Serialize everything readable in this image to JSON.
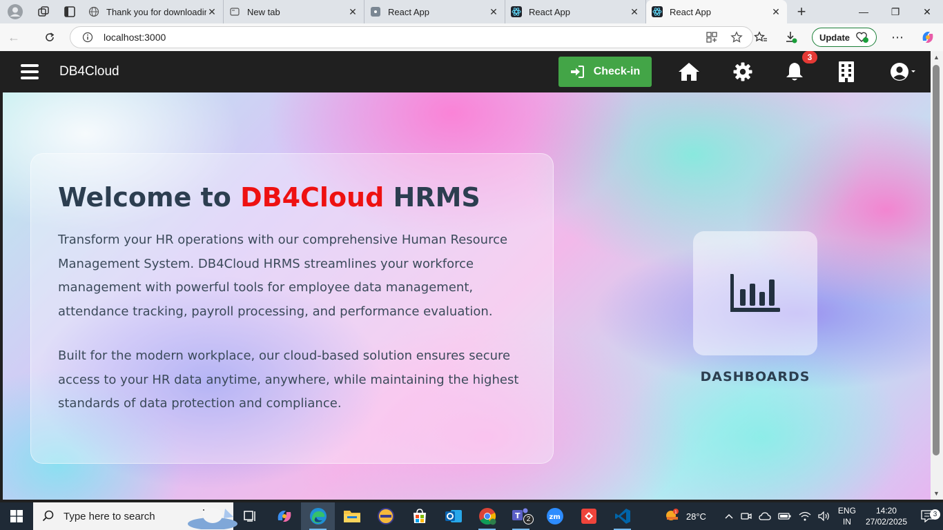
{
  "browser": {
    "tabs": [
      {
        "title": "Thank you for downloading",
        "active": false
      },
      {
        "title": "New tab",
        "active": false
      },
      {
        "title": "React App",
        "active": false
      },
      {
        "title": "React App",
        "active": false
      },
      {
        "title": "React App",
        "active": true
      }
    ],
    "url": "localhost:3000",
    "update_label": "Update"
  },
  "app": {
    "brand": "DB4Cloud",
    "checkin_label": "Check-in",
    "notification_count": "3",
    "welcome_prefix": "Welcome to ",
    "welcome_highlight": "DB4Cloud",
    "welcome_suffix": " HRMS",
    "paragraph1": "Transform your HR operations with our comprehensive Human Resource Management System. DB4Cloud HRMS streamlines your workforce management with powerful tools for employee data management, attendance tracking, payroll processing, and performance evaluation.",
    "paragraph2": "Built for the modern workplace, our cloud-based solution ensures secure access to your HR data anytime, anywhere, while maintaining the highest standards of data protection and compliance.",
    "dashboard_label": "DASHBOARDS",
    "colors": {
      "appbar": "#202020",
      "checkin": "#43a547",
      "highlight": "#ee1111",
      "heading": "#2c3e50"
    }
  },
  "taskbar": {
    "search_placeholder": "Type here to search",
    "weather": "28°C",
    "lang_line1": "ENG",
    "lang_line2": "IN",
    "time": "14:20",
    "date": "27/02/2025",
    "teams_badge": "2",
    "notif_badge": "3"
  }
}
